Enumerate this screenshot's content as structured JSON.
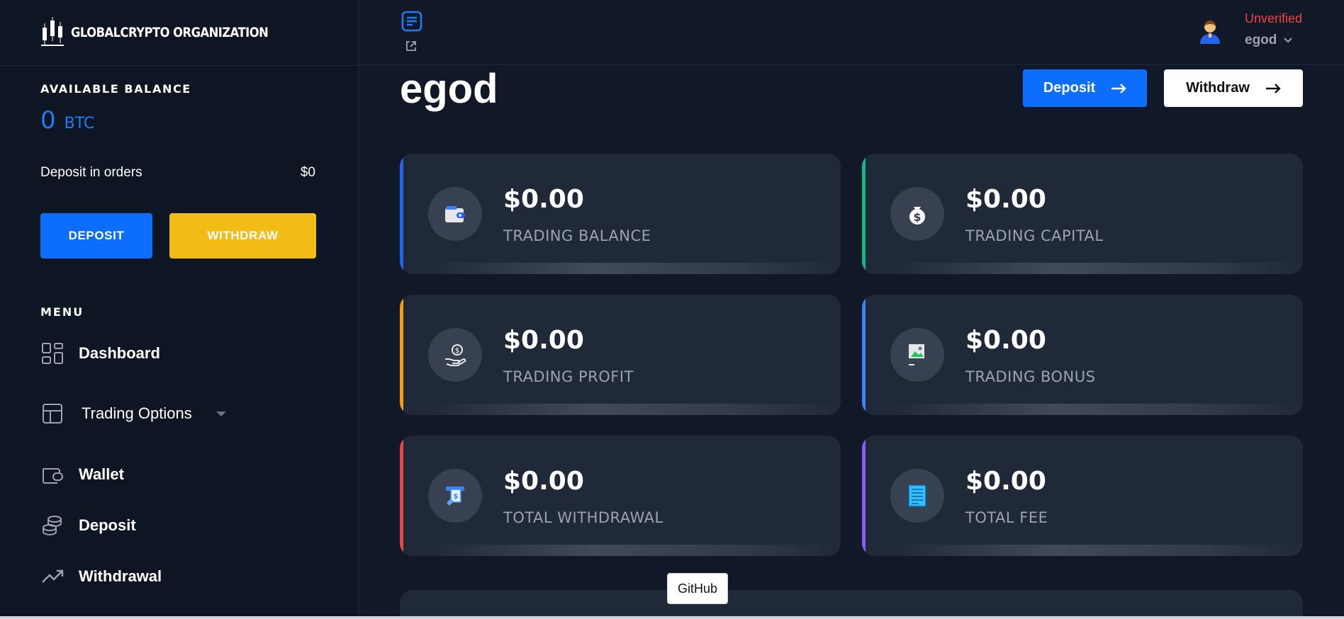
{
  "brand": {
    "name": "GLOBALCRYPTO ORGANIZATION"
  },
  "sidebar": {
    "balance_label": "AVAILABLE BALANCE",
    "balance_value": "0",
    "balance_unit": "BTC",
    "deposit_orders_label": "Deposit in orders",
    "deposit_orders_value": "$0",
    "deposit_button": "DEPOSIT",
    "withdraw_button": "WITHDRAW",
    "menu_label": "MENU",
    "items": [
      {
        "label": "Dashboard",
        "icon": "dashboard-icon"
      },
      {
        "label": "Trading Options",
        "icon": "layout-icon"
      },
      {
        "label": "Wallet",
        "icon": "wallet-icon"
      },
      {
        "label": "Deposit",
        "icon": "coins-icon"
      },
      {
        "label": "Withdrawal",
        "icon": "trending-up-icon"
      }
    ]
  },
  "header": {
    "status": "Unverified",
    "username": "egod"
  },
  "main": {
    "title": "egod",
    "deposit_button": "Deposit",
    "withdraw_button": "Withdraw",
    "cards": [
      {
        "amount": "$0.00",
        "label": "TRADING BALANCE",
        "accent": "#2563eb",
        "icon": "wallet-icon"
      },
      {
        "amount": "$0.00",
        "label": "TRADING CAPITAL",
        "accent": "#10b981",
        "icon": "money-bag-icon"
      },
      {
        "amount": "$0.00",
        "label": "TRADING PROFIT",
        "accent": "#f59e0b",
        "icon": "hand-coin-icon"
      },
      {
        "amount": "$0.00",
        "label": "TRADING BONUS",
        "accent": "#3b82f6",
        "icon": "broken-image-icon"
      },
      {
        "amount": "$0.00",
        "label": "TOTAL WITHDRAWAL",
        "accent": "#ef4444",
        "icon": "cash-withdraw-icon"
      },
      {
        "amount": "$0.00",
        "label": "TOTAL FEE",
        "accent": "#8b5cf6",
        "icon": "receipt-icon"
      }
    ]
  },
  "tooltip": {
    "text": "GitHub"
  },
  "colors": {
    "primary": "#0d6efd",
    "warning": "#f2bb16",
    "danger": "#ef4444",
    "background": "#111827",
    "sidebar": "#0f1623",
    "card": "#1f2937"
  }
}
